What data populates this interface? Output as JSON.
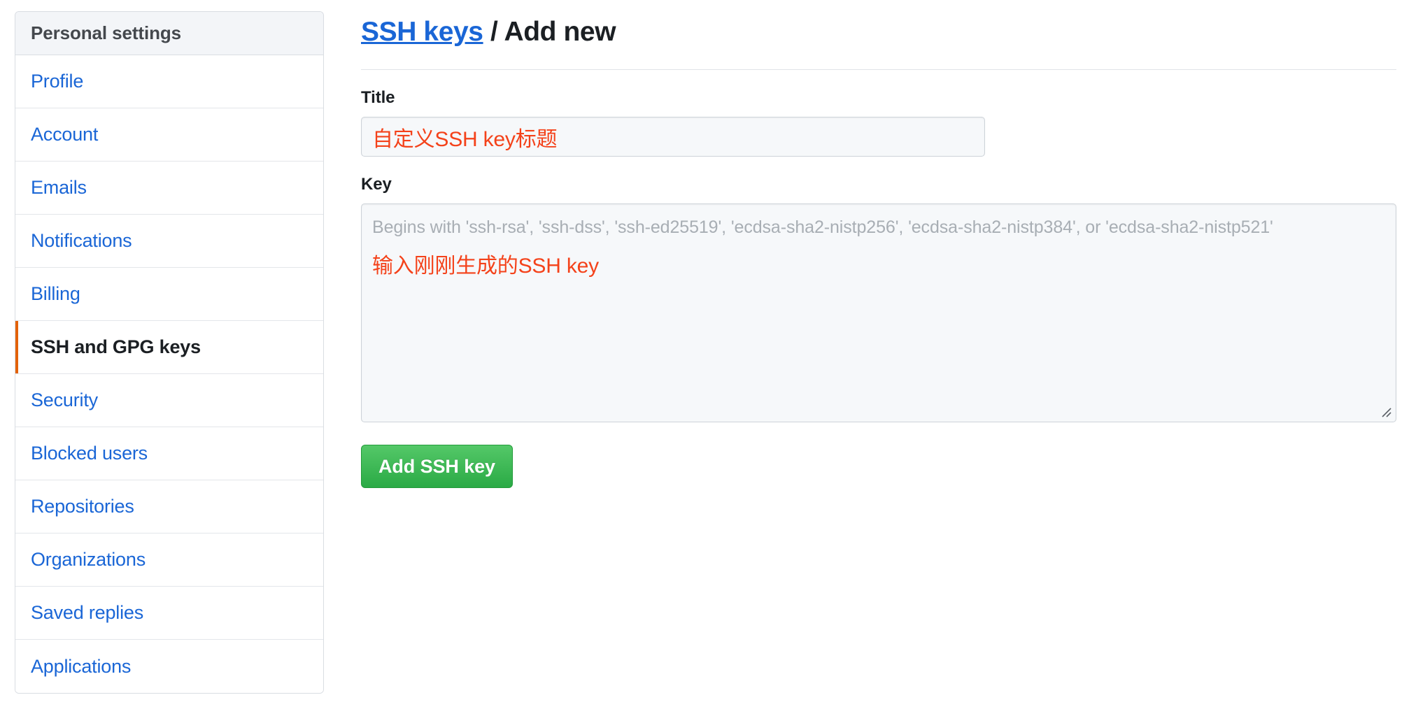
{
  "sidebar": {
    "header": "Personal settings",
    "items": [
      {
        "label": "Profile",
        "active": false
      },
      {
        "label": "Account",
        "active": false
      },
      {
        "label": "Emails",
        "active": false
      },
      {
        "label": "Notifications",
        "active": false
      },
      {
        "label": "Billing",
        "active": false
      },
      {
        "label": "SSH and GPG keys",
        "active": true
      },
      {
        "label": "Security",
        "active": false
      },
      {
        "label": "Blocked users",
        "active": false
      },
      {
        "label": "Repositories",
        "active": false
      },
      {
        "label": "Organizations",
        "active": false
      },
      {
        "label": "Saved replies",
        "active": false
      },
      {
        "label": "Applications",
        "active": false
      }
    ]
  },
  "header": {
    "link_text": "SSH keys",
    "separator": " / ",
    "current": "Add new"
  },
  "form": {
    "title_label": "Title",
    "title_value": "自定义SSH key标题",
    "key_label": "Key",
    "key_placeholder": "Begins with 'ssh-rsa', 'ssh-dss', 'ssh-ed25519', 'ecdsa-sha2-nistp256', 'ecdsa-sha2-nistp384', or 'ecdsa-sha2-nistp521'",
    "key_annotation": "输入刚刚生成的SSH key",
    "submit_label": "Add SSH key"
  },
  "colors": {
    "link_blue": "#1a66d6",
    "active_accent": "#e36209",
    "annotation_red": "#f4421a",
    "button_green": "#2aaa45",
    "field_bg": "#f6f8fa"
  },
  "icons": {
    "resize_grip": "resize-grip-icon"
  }
}
